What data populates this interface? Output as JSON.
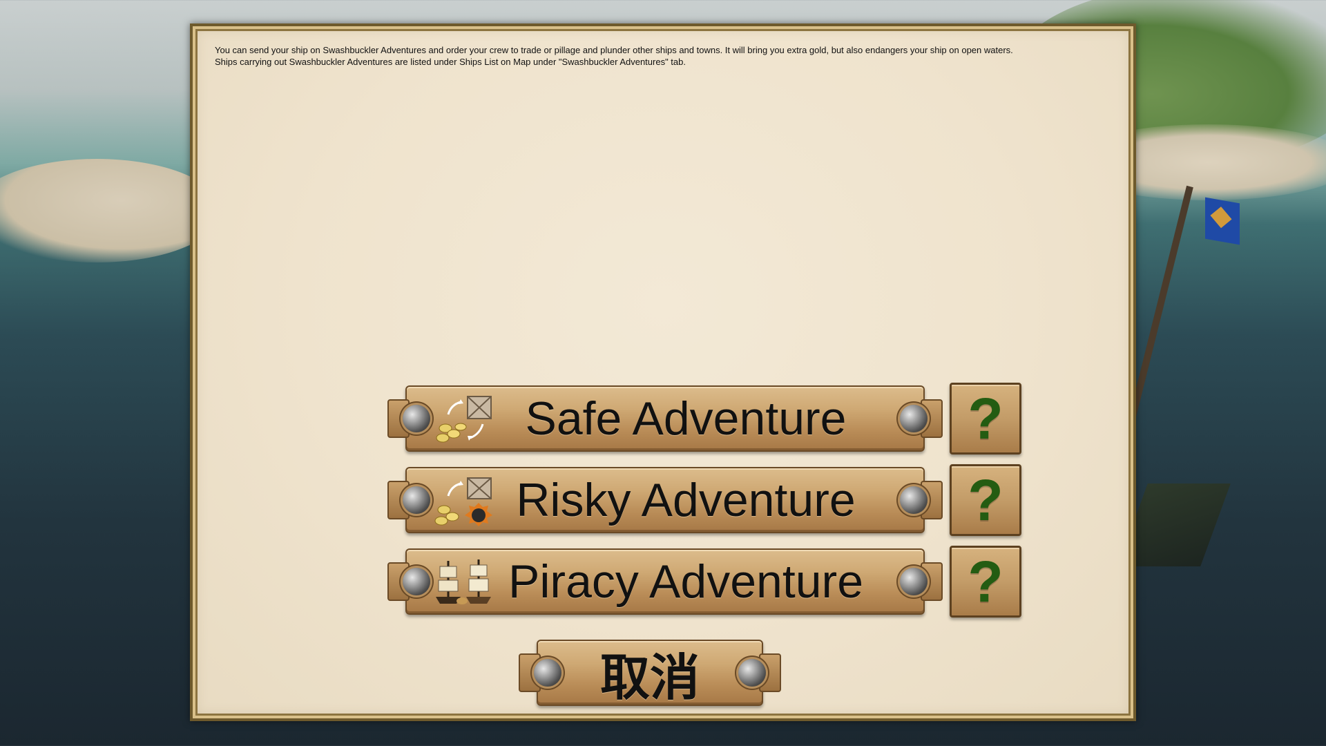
{
  "dialog": {
    "description_line1": "You can send your ship on Swashbuckler Adventures and order your crew to trade or pillage and plunder other ships and towns. It will bring you extra gold, but also endangers your ship on open waters.",
    "description_line2": "Ships carrying out Swashbuckler Adventures are listed under Ships List on Map under \"Swashbuckler Adventures\" tab."
  },
  "buttons": {
    "safe": {
      "label": "Safe Adventure",
      "help": "?",
      "icon": "trade-coins-crate-icon"
    },
    "risky": {
      "label": "Risky Adventure",
      "help": "?",
      "icon": "trade-coins-bomb-icon"
    },
    "piracy": {
      "label": "Piracy Adventure",
      "help": "?",
      "icon": "ships-plunder-icon"
    },
    "cancel": {
      "label": "取消"
    }
  },
  "colors": {
    "help_mark": "#245c12",
    "parchment": "#efe3cd",
    "button_wood": "#c39c68"
  }
}
